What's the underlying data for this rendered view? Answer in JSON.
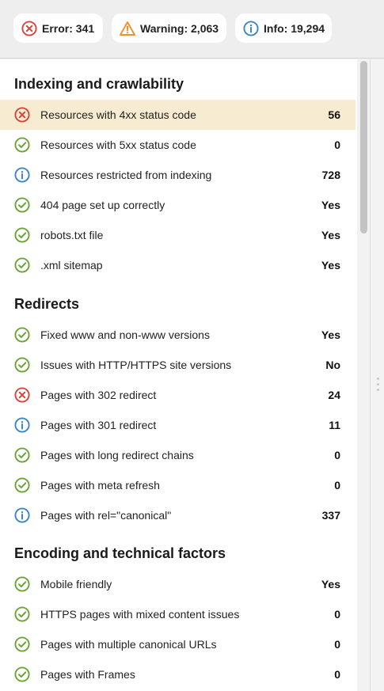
{
  "summary": {
    "error_label": "Error: 341",
    "warning_label": "Warning: 2,063",
    "info_label": "Info: 19,294"
  },
  "colors": {
    "error": "#d9443a",
    "warning": "#f0922b",
    "info": "#3a86c8",
    "ok": "#6aa534",
    "highlight": "#f7ecd1"
  },
  "sections": [
    {
      "title": "Indexing and crawlability",
      "rows": [
        {
          "status": "error",
          "label": "Resources with 4xx status code",
          "value": "56"
        },
        {
          "status": "ok",
          "label": "Resources with 5xx status code",
          "value": "0"
        },
        {
          "status": "info",
          "label": "Resources restricted from indexing",
          "value": "728"
        },
        {
          "status": "ok",
          "label": "404 page set up correctly",
          "value": "Yes"
        },
        {
          "status": "ok",
          "label": "robots.txt file",
          "value": "Yes"
        },
        {
          "status": "ok",
          "label": ".xml sitemap",
          "value": "Yes"
        }
      ]
    },
    {
      "title": "Redirects",
      "rows": [
        {
          "status": "ok",
          "label": "Fixed www and non-www versions",
          "value": "Yes"
        },
        {
          "status": "ok",
          "label": "Issues with HTTP/HTTPS site versions",
          "value": "No"
        },
        {
          "status": "error",
          "label": "Pages with 302 redirect",
          "value": "24"
        },
        {
          "status": "info",
          "label": "Pages with 301 redirect",
          "value": "11"
        },
        {
          "status": "ok",
          "label": "Pages with long redirect chains",
          "value": "0"
        },
        {
          "status": "ok",
          "label": "Pages with meta refresh",
          "value": "0"
        },
        {
          "status": "info",
          "label": "Pages with rel=\"canonical\"",
          "value": "337"
        }
      ]
    },
    {
      "title": "Encoding and technical factors",
      "rows": [
        {
          "status": "ok",
          "label": "Mobile friendly",
          "value": "Yes"
        },
        {
          "status": "ok",
          "label": "HTTPS pages with mixed content issues",
          "value": "0"
        },
        {
          "status": "ok",
          "label": "Pages with multiple canonical URLs",
          "value": "0"
        },
        {
          "status": "ok",
          "label": "Pages with Frames",
          "value": "0"
        }
      ]
    }
  ]
}
